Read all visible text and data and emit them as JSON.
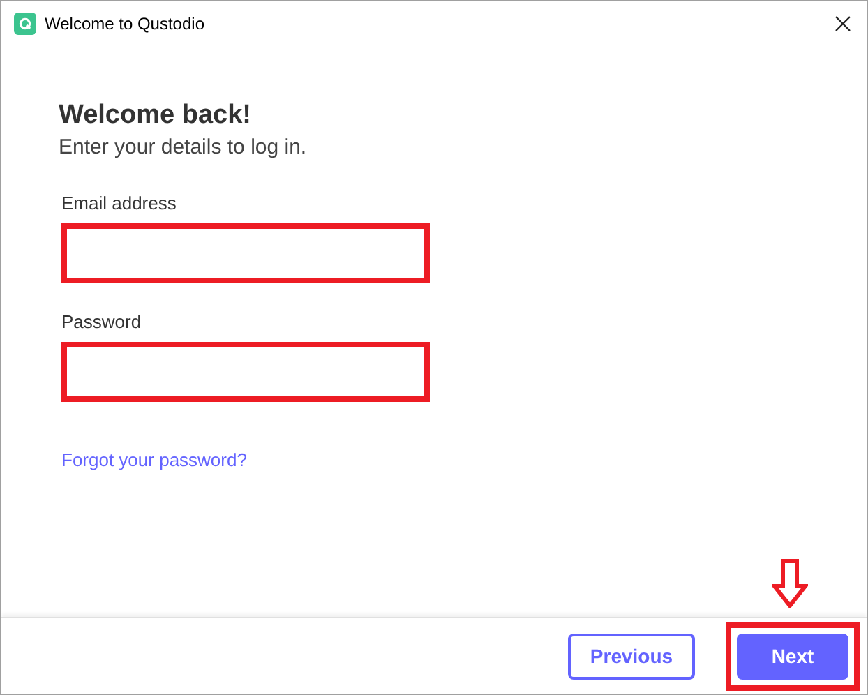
{
  "window": {
    "title": "Welcome to Qustodio"
  },
  "heading": "Welcome back!",
  "subheading": "Enter your details to log in.",
  "fields": [
    {
      "label": "Email address",
      "highlighted": true
    },
    {
      "label": "Password",
      "highlighted": true
    }
  ],
  "forgot_link": "Forgot your password?",
  "buttons": [
    {
      "label": "Previous",
      "kind": "secondary",
      "highlighted": false
    },
    {
      "label": "Next",
      "kind": "primary",
      "highlighted": true
    }
  ]
}
